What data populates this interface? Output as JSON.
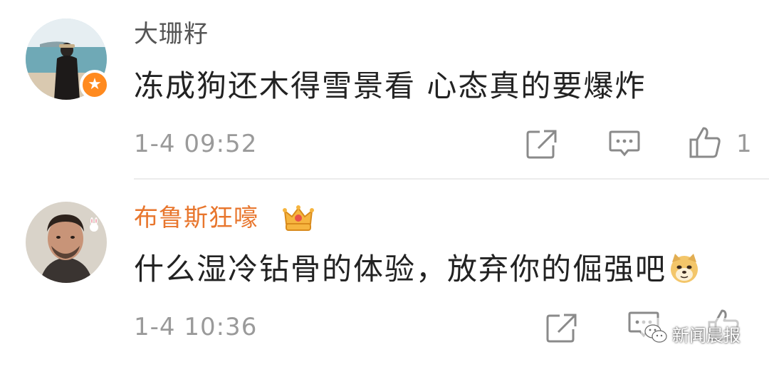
{
  "comments": [
    {
      "username": "大珊籽",
      "text": "冻成狗还木得雪景看 心态真的要爆炸",
      "time": "1-4 09:52",
      "likes": "1",
      "badge_icon": "star-badge-icon"
    },
    {
      "username": "布鲁斯狂嚎",
      "text": "什么湿冷钻骨的体验，放弃你的倔强吧",
      "time": "1-4 10:36",
      "likes": "",
      "emoji": "doge-emoji-icon"
    }
  ],
  "watermark": {
    "text": "新闻晨报"
  },
  "colors": {
    "username_default": "#555555",
    "username_vip": "#e8762d",
    "meta_gray": "#9a9a9a",
    "badge_orange": "#ff8a1f"
  }
}
